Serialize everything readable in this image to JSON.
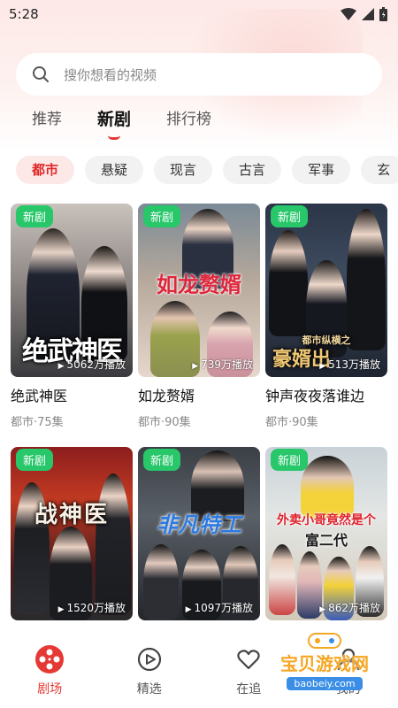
{
  "status_bar": {
    "time": "5:28"
  },
  "search": {
    "placeholder": "搜你想看的视频"
  },
  "tabs": [
    {
      "label": "推荐",
      "active": false
    },
    {
      "label": "新剧",
      "active": true
    },
    {
      "label": "排行榜",
      "active": false
    }
  ],
  "chips": [
    "都市",
    "悬疑",
    "现言",
    "古言",
    "军事",
    "玄"
  ],
  "cards": [
    {
      "tag": "新剧",
      "art_title": "绝武神医",
      "plays": "5062万播放",
      "title": "绝武神医",
      "meta": "都市·75集"
    },
    {
      "tag": "新剧",
      "art_title": "如龙赘婿",
      "plays": "739万播放",
      "title": "如龙赘婿",
      "meta": "都市·90集"
    },
    {
      "tag": "新剧",
      "art_title": "豪婿出",
      "art_subtitle": "都市纵横之",
      "plays": "513万播放",
      "title": "钟声夜夜落谁边",
      "meta": "都市·90集"
    },
    {
      "tag": "新剧",
      "art_title": "战神医",
      "plays": "1520万播放"
    },
    {
      "tag": "新剧",
      "art_title": "非凡特工",
      "plays": "1097万播放"
    },
    {
      "tag": "新剧",
      "art_title": "外卖小哥竟然是个",
      "art_subtitle": "富二代",
      "plays": "862万播放"
    }
  ],
  "bottom_nav": [
    {
      "label": "剧场",
      "icon": "film-reel-icon",
      "active": true
    },
    {
      "label": "精选",
      "icon": "play-circle-icon",
      "active": false
    },
    {
      "label": "在追",
      "icon": "heart-icon",
      "active": false
    },
    {
      "label": "我的",
      "icon": "user-icon",
      "active": false
    }
  ],
  "watermark": {
    "text": "宝贝游戏网",
    "url": "baobeiy.com"
  },
  "colors": {
    "accent": "#e53935",
    "tag_green": "#27c76a",
    "chip_active_bg": "#fde8e8"
  }
}
